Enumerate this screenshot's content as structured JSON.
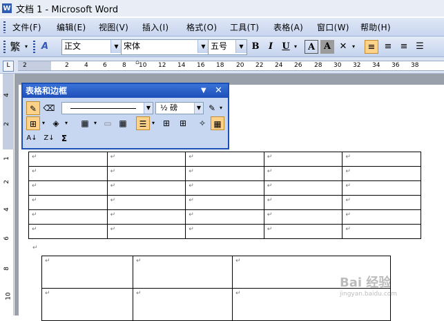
{
  "window": {
    "title": "文档 1 - Microsoft Word",
    "app_icon": "W"
  },
  "menu": {
    "items": [
      "文件(F)",
      "编辑(E)",
      "视图(V)",
      "插入(I)",
      "格式(O)",
      "工具(T)",
      "表格(A)",
      "窗口(W)",
      "帮助(H)"
    ]
  },
  "toolbar": {
    "traditional": "繁",
    "style_value": "正文",
    "font_value": "宋体",
    "size_value": "五号",
    "bold": "B",
    "italic": "I",
    "underline": "U",
    "char_border": "A",
    "char_shading": "A"
  },
  "ruler": {
    "corner": "L",
    "labels": [
      "2",
      "2",
      "4",
      "6",
      "8",
      "10",
      "12",
      "14",
      "16",
      "18",
      "20",
      "22",
      "24",
      "26",
      "28",
      "30",
      "32",
      "34",
      "36",
      "38"
    ],
    "vertical_labels": [
      "4",
      "2",
      "1",
      "2",
      "4",
      "6",
      "8",
      "10"
    ]
  },
  "float_toolbar": {
    "title": "表格和边框",
    "line_weight": "½ 磅",
    "sum": "Σ"
  },
  "paragraph_mark": "↵",
  "table1": {
    "rows": 6,
    "cols": 5,
    "cell": "↵"
  },
  "table2": {
    "rows": 2,
    "cols": 3,
    "cell": "↵"
  },
  "watermark": {
    "line1": "Bai 经验",
    "line2": "jingyan.baidu.com"
  }
}
